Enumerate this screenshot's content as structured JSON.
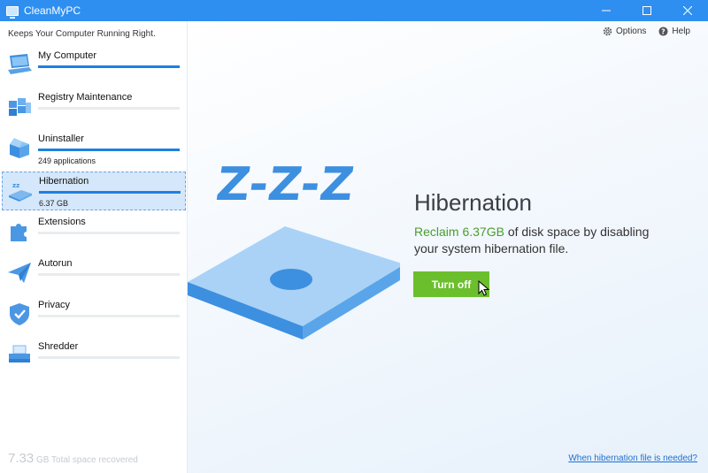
{
  "window": {
    "title": "CleanMyPC"
  },
  "sidebar": {
    "tagline": "Keeps Your Computer Running Right.",
    "items": [
      {
        "label": "My Computer",
        "sub": "",
        "progress": 1.0,
        "icon": "laptop-icon"
      },
      {
        "label": "Registry Maintenance",
        "sub": "",
        "progress": 0,
        "icon": "registry-cubes-icon"
      },
      {
        "label": "Uninstaller",
        "sub": "249 applications",
        "progress": 1.0,
        "icon": "box-icon"
      },
      {
        "label": "Hibernation",
        "sub": "6.37 GB",
        "progress": 1.0,
        "icon": "hibernation-icon"
      },
      {
        "label": "Extensions",
        "sub": "",
        "progress": 0,
        "icon": "puzzle-icon"
      },
      {
        "label": "Autorun",
        "sub": "",
        "progress": 0,
        "icon": "paper-plane-icon"
      },
      {
        "label": "Privacy",
        "sub": "",
        "progress": 0,
        "icon": "shield-icon"
      },
      {
        "label": "Shredder",
        "sub": "",
        "progress": 0,
        "icon": "shredder-icon"
      }
    ],
    "recovered_value": "7.33",
    "recovered_label": "GB Total space recovered"
  },
  "topbar": {
    "options_label": "Options",
    "help_label": "Help"
  },
  "main": {
    "art_text": "Z-Z-Z",
    "headline": "Hibernation",
    "desc_highlight": "Reclaim 6.37GB",
    "desc_rest": " of disk space by disabling your system hibernation file.",
    "button_label": "Turn off",
    "help_link": "When hibernation file is needed?"
  },
  "colors": {
    "titlebar": "#2e8ff0",
    "accent": "#1f7fe0",
    "button": "#6bbf2d",
    "highlight": "#4a9d2e"
  }
}
